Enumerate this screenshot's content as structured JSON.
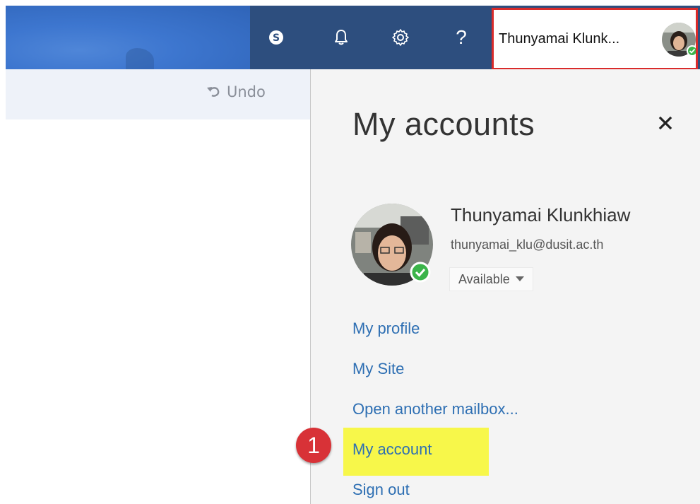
{
  "topbar": {
    "icons": [
      "skype-icon",
      "bell-icon",
      "gear-icon",
      "help-icon"
    ],
    "help_glyph": "?",
    "user_name": "Thunyamai Klunk...",
    "colors": {
      "bar": "#2d4e7e",
      "highlight_border": "#d92b2b"
    }
  },
  "toolbar": {
    "undo_label": "Undo"
  },
  "panel": {
    "title": "My accounts",
    "close_glyph": "×",
    "profile": {
      "name": "Thunyamai Klunkhiaw",
      "email": "thunyamai_klu@dusit.ac.th",
      "status": "Available",
      "presence_color": "#3bb44a"
    },
    "links": {
      "my_profile": "My profile",
      "my_site": "My Site",
      "open_mailbox": "Open another mailbox...",
      "my_account": "My account",
      "sign_out": "Sign out"
    },
    "link_color": "#2e6fb3"
  },
  "annotation": {
    "step_number": "1",
    "highlight_color": "#f7f74a",
    "badge_color": "#d83237"
  }
}
